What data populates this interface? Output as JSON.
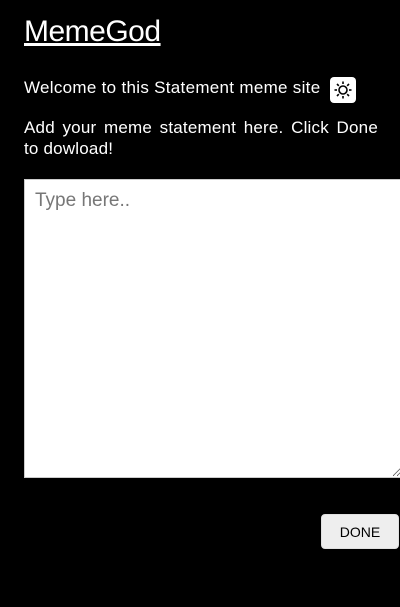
{
  "header": {
    "title": "MemeGod"
  },
  "welcome": {
    "text": "Welcome to this Statement meme site",
    "theme_toggle_icon": "sun-icon"
  },
  "instruction": {
    "text": "Add your meme statement here. Click Done to dowload!"
  },
  "editor": {
    "placeholder": "Type here..",
    "value": ""
  },
  "actions": {
    "done_label": "DONE"
  },
  "colors": {
    "background": "#000000",
    "text": "#ffffff",
    "button_bg": "#eeeeee"
  }
}
